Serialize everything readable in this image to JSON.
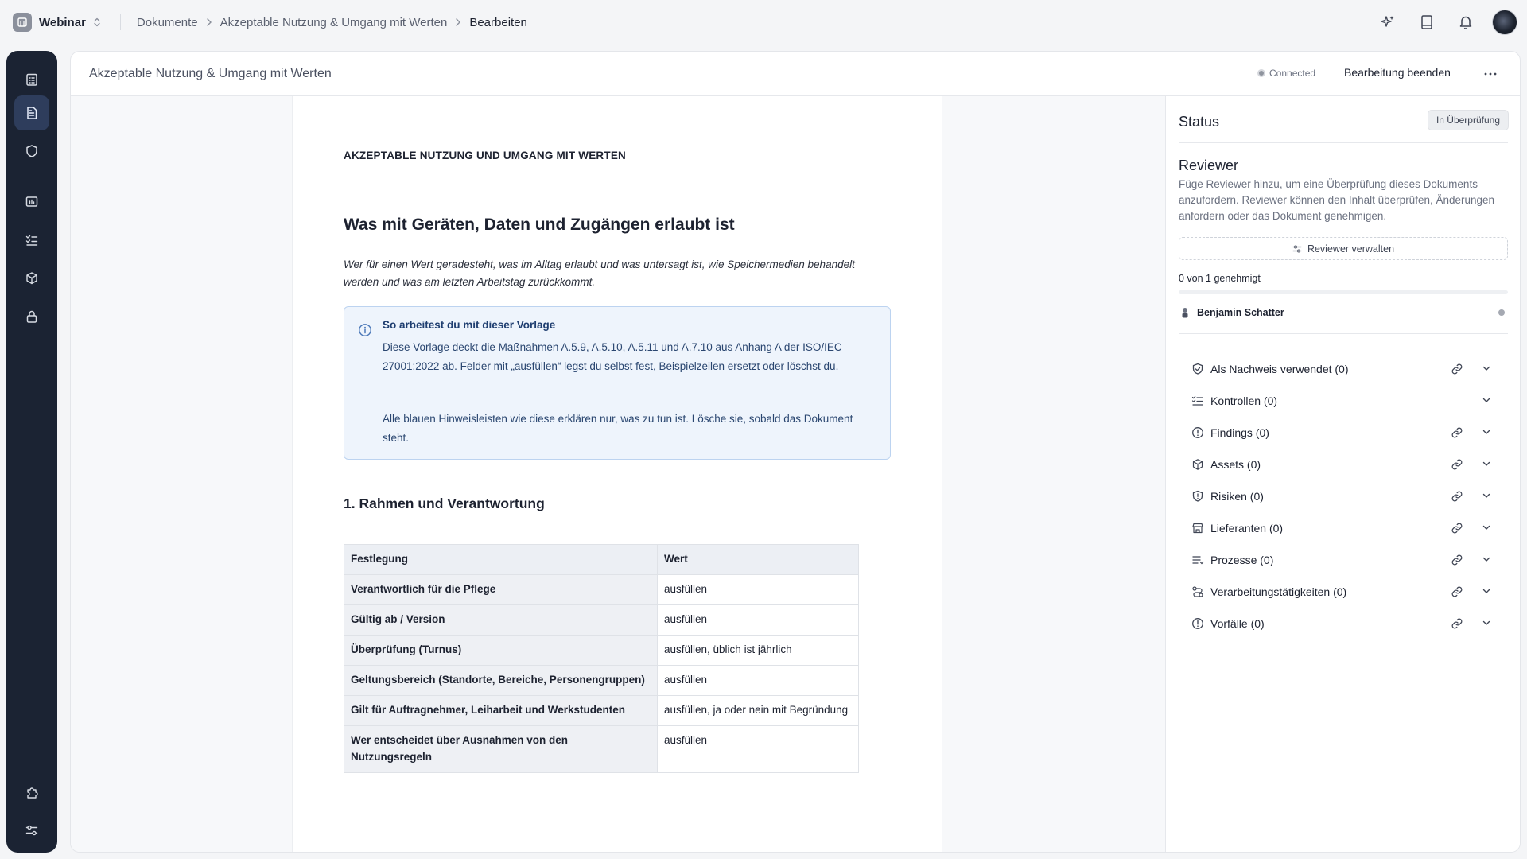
{
  "topbar": {
    "workspace": "Webinar",
    "breadcrumbs": [
      "Dokumente",
      "Akzeptable Nutzung & Umgang mit Werten",
      "Bearbeiten"
    ]
  },
  "header": {
    "doc_title": "Akzeptable Nutzung & Umgang mit Werten",
    "connection": "Connected",
    "end_edit": "Bearbeitung beenden"
  },
  "document": {
    "kicker": "AKZEPTABLE NUTZUNG UND UMGANG MIT WERTEN",
    "h1": "Was mit Geräten, Daten und Zugängen erlaubt ist",
    "lead": "Wer für einen Wert geradesteht, was im Alltag erlaubt und was untersagt ist, wie Speichermedien behandelt werden und was am letzten Arbeitstag zurückkommt.",
    "callout": {
      "title": "So arbeitest du mit dieser Vorlage",
      "p1": "Diese Vorlage deckt die Maßnahmen A.5.9, A.5.10, A.5.11 und A.7.10 aus Anhang A der ISO/IEC 27001:2022 ab. Felder mit „ausfüllen“ legst du selbst fest, Beispielzeilen ersetzt oder löschst du.",
      "p2": "Alle blauen Hinweisleisten wie diese erklären nur, was zu tun ist. Lösche sie, sobald das Dokument steht."
    },
    "h2": "1. Rahmen und Verantwortung",
    "table": {
      "headers": [
        "Festlegung",
        "Wert"
      ],
      "rows": [
        {
          "k": "Verantwortlich für die Pflege",
          "v": "ausfüllen"
        },
        {
          "k": "Gültig ab / Version",
          "v": "ausfüllen"
        },
        {
          "k": "Überprüfung (Turnus)",
          "v": "ausfüllen, üblich ist jährlich"
        },
        {
          "k": "Geltungsbereich (Standorte, Bereiche, Personengruppen)",
          "v": "ausfüllen"
        },
        {
          "k": "Gilt für Auftragnehmer, Leiharbeit und Werkstudenten",
          "v": "ausfüllen, ja oder nein mit Begründung"
        },
        {
          "k": "Wer entscheidet über Ausnahmen von den Nutzungsregeln",
          "v": "ausfüllen"
        }
      ]
    }
  },
  "panel": {
    "status_label": "Status",
    "status_badge": "In Überprüfung",
    "reviewer_title": "Reviewer",
    "reviewer_desc": "Füge Reviewer hinzu, um eine Überprüfung dieses Dokuments anzufordern. Reviewer können den Inhalt überprüfen, Änderungen anfordern oder das Dokument genehmigen.",
    "manage_reviewers": "Reviewer verwalten",
    "approved_text": "0 von 1 genehmigt",
    "approved_fraction": 0,
    "reviewer_name": "Benjamin Schatter",
    "links": [
      {
        "label": "Als Nachweis verwendet (0)",
        "icon": "shield-check-icon"
      },
      {
        "label": "Kontrollen (0)",
        "icon": "list-checks-icon"
      },
      {
        "label": "Findings (0)",
        "icon": "alert-circle-icon"
      },
      {
        "label": "Assets (0)",
        "icon": "boxes-icon"
      },
      {
        "label": "Risiken (0)",
        "icon": "shield-alert-icon"
      },
      {
        "label": "Lieferanten (0)",
        "icon": "store-icon"
      },
      {
        "label": "Prozesse (0)",
        "icon": "list-process-icon"
      },
      {
        "label": "Verarbeitungstätigkeiten (0)",
        "icon": "route-icon"
      },
      {
        "label": "Vorfälle (0)",
        "icon": "alert-circle-icon"
      }
    ]
  },
  "colors": {
    "sidebar": "#1b2333",
    "sidebar_active": "#2e3d5c",
    "callout_bg": "#eef4fc",
    "callout_border": "#bcd3f0"
  }
}
